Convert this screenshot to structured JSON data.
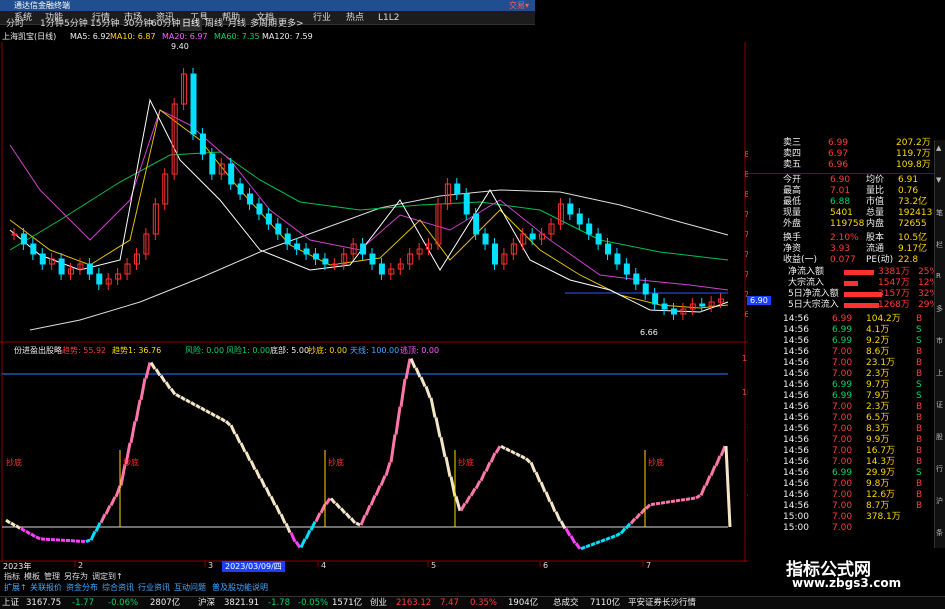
{
  "title_bar": {
    "title": "通达信金融终端",
    "right": "交易▾"
  },
  "menu": [
    "系统",
    "功能",
    "行情",
    "市场",
    "资讯",
    "工具",
    "帮助",
    "文档",
    "行业",
    "热点",
    "L1L2"
  ],
  "timeframes": [
    "分时",
    "1分钟",
    "5分钟",
    "15分钟",
    "30分钟",
    "60分钟",
    "日线",
    "周线",
    "月线",
    "多周期",
    "更多>"
  ],
  "timeframe_selected_index": 6,
  "ma_bar": {
    "stock": "上海凯宝(日线)",
    "ma5": "MA5: 6.92",
    "ma10": "MA10: 6.87",
    "ma20": "MA20: 6.97",
    "ma60": "MA60: 7.35",
    "ma120": "MA120: 7.59"
  },
  "price_axis": [
    "8.40",
    "8.20",
    "8.00",
    "7.80",
    "7.60",
    "7.40",
    "7.20",
    "7.00",
    "6.80"
  ],
  "price_annotations": {
    "high": "9.40",
    "low": "6.66",
    "current": "6.90"
  },
  "indicator_bar": {
    "name": "份进盈出股略",
    "a": "趋势: 55.92",
    "b": "趋势1: 36.76",
    "c": "风险: 0.00",
    "d": "风险1: 0.00",
    "e": "底部: 5.00",
    "f": "抄底: 0.00",
    "g": "天线: 100.00",
    "h": "逃顶: 0.00"
  },
  "indicator_axis": [
    "120.00",
    "100.00",
    "80.00",
    "60.00",
    "40.00",
    "20.00"
  ],
  "indicator_labels": {
    "low_marks": [
      "抄底",
      "抄底",
      "抄底",
      "抄底",
      "抄底"
    ]
  },
  "x_axis": {
    "year": "2023年",
    "ticks": [
      "2",
      "3",
      "4",
      "5",
      "6",
      "7"
    ],
    "cursor_date": "2023/03/09/四"
  },
  "right_panel": {
    "book": [
      {
        "label": "卖三",
        "price": "6.99",
        "vol": "207.2万"
      },
      {
        "label": "卖四",
        "price": "6.97",
        "vol": "119.7万"
      },
      {
        "label": "卖五",
        "price": "6.96",
        "vol": "109.8万"
      }
    ],
    "stats": [
      {
        "l1": "今开",
        "v1": "6.90",
        "l2": "均价",
        "v2": "6.91"
      },
      {
        "l1": "最高",
        "v1": "7.01",
        "l2": "量比",
        "v2": "0.76"
      },
      {
        "l1": "最低",
        "v1": "6.88",
        "l2": "市值",
        "v2": "73.2亿"
      },
      {
        "l1": "现量",
        "v1": "5401",
        "l2": "总量",
        "v2": "192413"
      },
      {
        "l1": "外盘",
        "v1": "119758",
        "l2": "内盘",
        "v2": "72655"
      },
      {
        "l1": "换手",
        "v1": "2.10%",
        "l2": "股本",
        "v2": "10.5亿"
      },
      {
        "l1": "净资",
        "v1": "3.93",
        "l2": "流通",
        "v2": "9.17亿"
      },
      {
        "l1": "收益(一)",
        "v1": "0.077",
        "l2": "PE(动)",
        "v2": "22.8"
      }
    ],
    "flows": [
      {
        "label": "净流入额",
        "value": "3381万",
        "pct": "25%",
        "fill": 0.25
      },
      {
        "label": "大宗流入",
        "value": "1547万",
        "pct": "12%",
        "fill": 0.12
      },
      {
        "label": "5日净流入额",
        "value": "3157万",
        "pct": "32%",
        "fill": 0.32
      },
      {
        "label": "5日大宗流入",
        "value": "1268万",
        "pct": "29%",
        "fill": 0.29
      }
    ],
    "ticks": [
      {
        "t": "14:56",
        "p": "6.99",
        "v": "104.2万",
        "b": "B"
      },
      {
        "t": "14:56",
        "p": "6.99",
        "v": "4.1万",
        "b": "S"
      },
      {
        "t": "14:56",
        "p": "6.99",
        "v": "9.2万",
        "b": "S"
      },
      {
        "t": "14:56",
        "p": "7.00",
        "v": "8.6万",
        "b": "B"
      },
      {
        "t": "14:56",
        "p": "7.00",
        "v": "23.1万",
        "b": "B"
      },
      {
        "t": "14:56",
        "p": "7.00",
        "v": "2.3万",
        "b": "B"
      },
      {
        "t": "14:56",
        "p": "6.99",
        "v": "9.7万",
        "b": "S"
      },
      {
        "t": "14:56",
        "p": "6.99",
        "v": "7.9万",
        "b": "S"
      },
      {
        "t": "14:56",
        "p": "7.00",
        "v": "2.3万",
        "b": "B"
      },
      {
        "t": "14:56",
        "p": "7.00",
        "v": "6.5万",
        "b": "B"
      },
      {
        "t": "14:56",
        "p": "7.00",
        "v": "8.3万",
        "b": "B"
      },
      {
        "t": "14:56",
        "p": "7.00",
        "v": "9.9万",
        "b": "B"
      },
      {
        "t": "14:56",
        "p": "7.00",
        "v": "16.7万",
        "b": "B"
      },
      {
        "t": "14:56",
        "p": "7.00",
        "v": "14.3万",
        "b": "B"
      },
      {
        "t": "14:56",
        "p": "6.99",
        "v": "29.9万",
        "b": "S"
      },
      {
        "t": "14:56",
        "p": "7.00",
        "v": "9.8万",
        "b": "B"
      },
      {
        "t": "14:56",
        "p": "7.00",
        "v": "12.6万",
        "b": "B"
      },
      {
        "t": "14:56",
        "p": "7.00",
        "v": "8.7万",
        "b": "B"
      },
      {
        "t": "15:00",
        "p": "7.00",
        "v": "378.1万",
        "b": ""
      },
      {
        "t": "15:00",
        "p": "7.00",
        "v": "",
        "b": ""
      }
    ]
  },
  "watermark": {
    "title": "指标公式网",
    "url": "www.zbgs3.com"
  },
  "tabs_row1": [
    "指标",
    "模板",
    "管理",
    "另存为",
    "调定到↑"
  ],
  "tabs_row2": [
    "扩展↑",
    "关联报价",
    "资金分布",
    "综合资讯",
    "行业资讯",
    "互动问题",
    "普及股功能说明"
  ],
  "status": {
    "sh_label": "上证",
    "sh_val": "3167.75",
    "sh_chg": "-1.77",
    "sh_pct": "-0.06%",
    "sh_amt": "2807亿",
    "sz_label": "沪深",
    "sz_val": "3821.91",
    "sz_chg": "-1.78",
    "sz_pct": "-0.05%",
    "sz_amt": "1571亿",
    "cy_label": "创业",
    "cy_val": "2163.12",
    "cy_chg": "7.47",
    "cy_pct": "0.35%",
    "cy_amt": "1904亿",
    "total_label": "总成交",
    "total_val": "7110亿",
    "broker": "平安证券长沙行情"
  },
  "sidebar": [
    "▲",
    "▼",
    "笔",
    "栏",
    "R",
    "多",
    "市",
    "上",
    "证",
    "股",
    "行",
    "沪",
    "条"
  ]
}
